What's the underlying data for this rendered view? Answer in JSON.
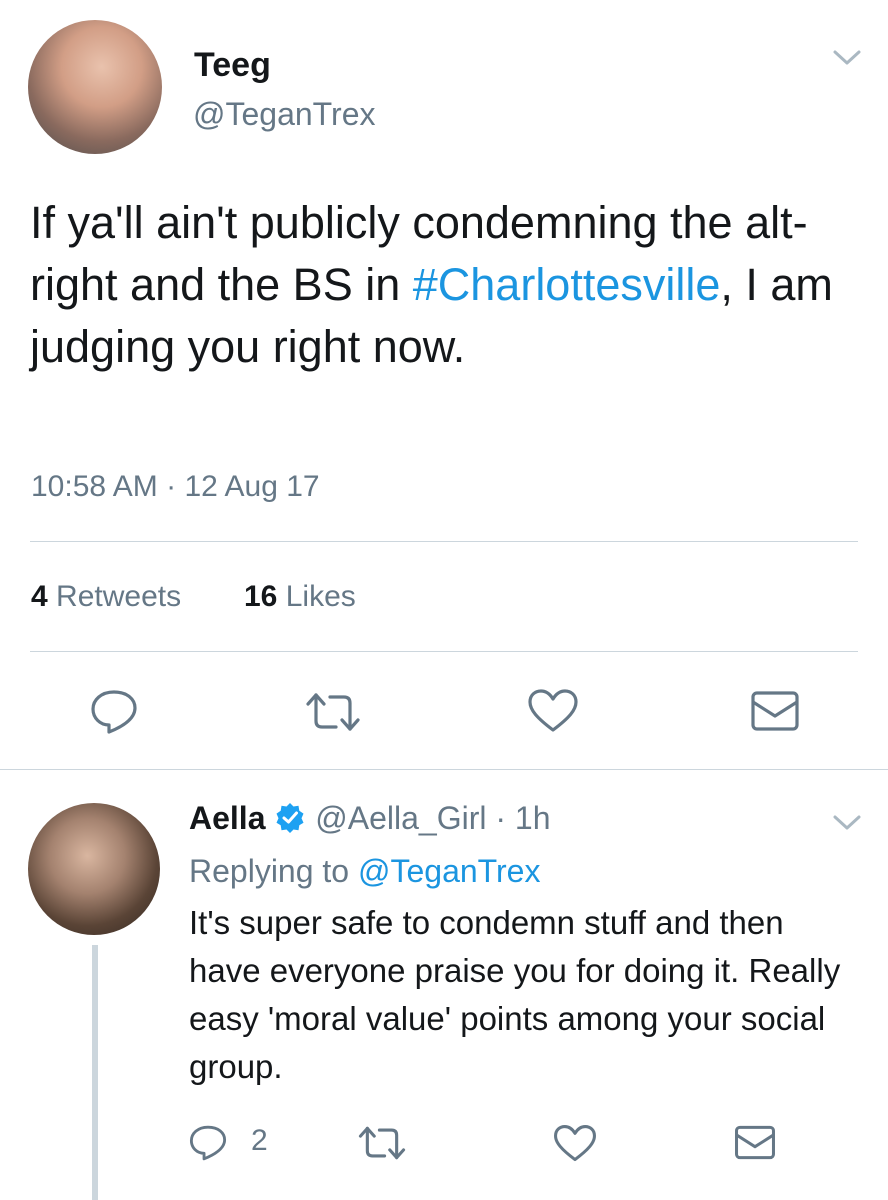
{
  "tweet": {
    "display_name": "Teeg",
    "handle": "@TeganTrex",
    "text_before": "If ya'll ain't publicly condemning the alt-right and the BS in ",
    "hashtag": "#Charlottesville",
    "text_after": ", I am judging you right now.",
    "time": "10:58 AM",
    "separator": "·",
    "date": "12 Aug 17",
    "retweet_count": "4",
    "retweet_label": "Retweets",
    "like_count": "16",
    "like_label": "Likes"
  },
  "reply": {
    "display_name": "Aella",
    "handle": "@Aella_Girl",
    "separator": "·",
    "age": "1h",
    "replying_prefix": "Replying to",
    "replying_to": "@TeganTrex",
    "text": "It's super safe to condemn stuff and then have everyone praise you for doing it. Really easy 'moral value' points among your social group.",
    "reply_count": "2"
  },
  "icons": {
    "chevron": "chevron-down-icon",
    "reply": "reply-icon",
    "retweet": "retweet-icon",
    "like": "heart-icon",
    "dm": "envelope-icon",
    "verified": "verified-badge-icon"
  },
  "colors": {
    "link": "#1b95e0",
    "secondary_text": "#657786",
    "divider": "#ccd6dd",
    "verified": "#1da1f2"
  }
}
